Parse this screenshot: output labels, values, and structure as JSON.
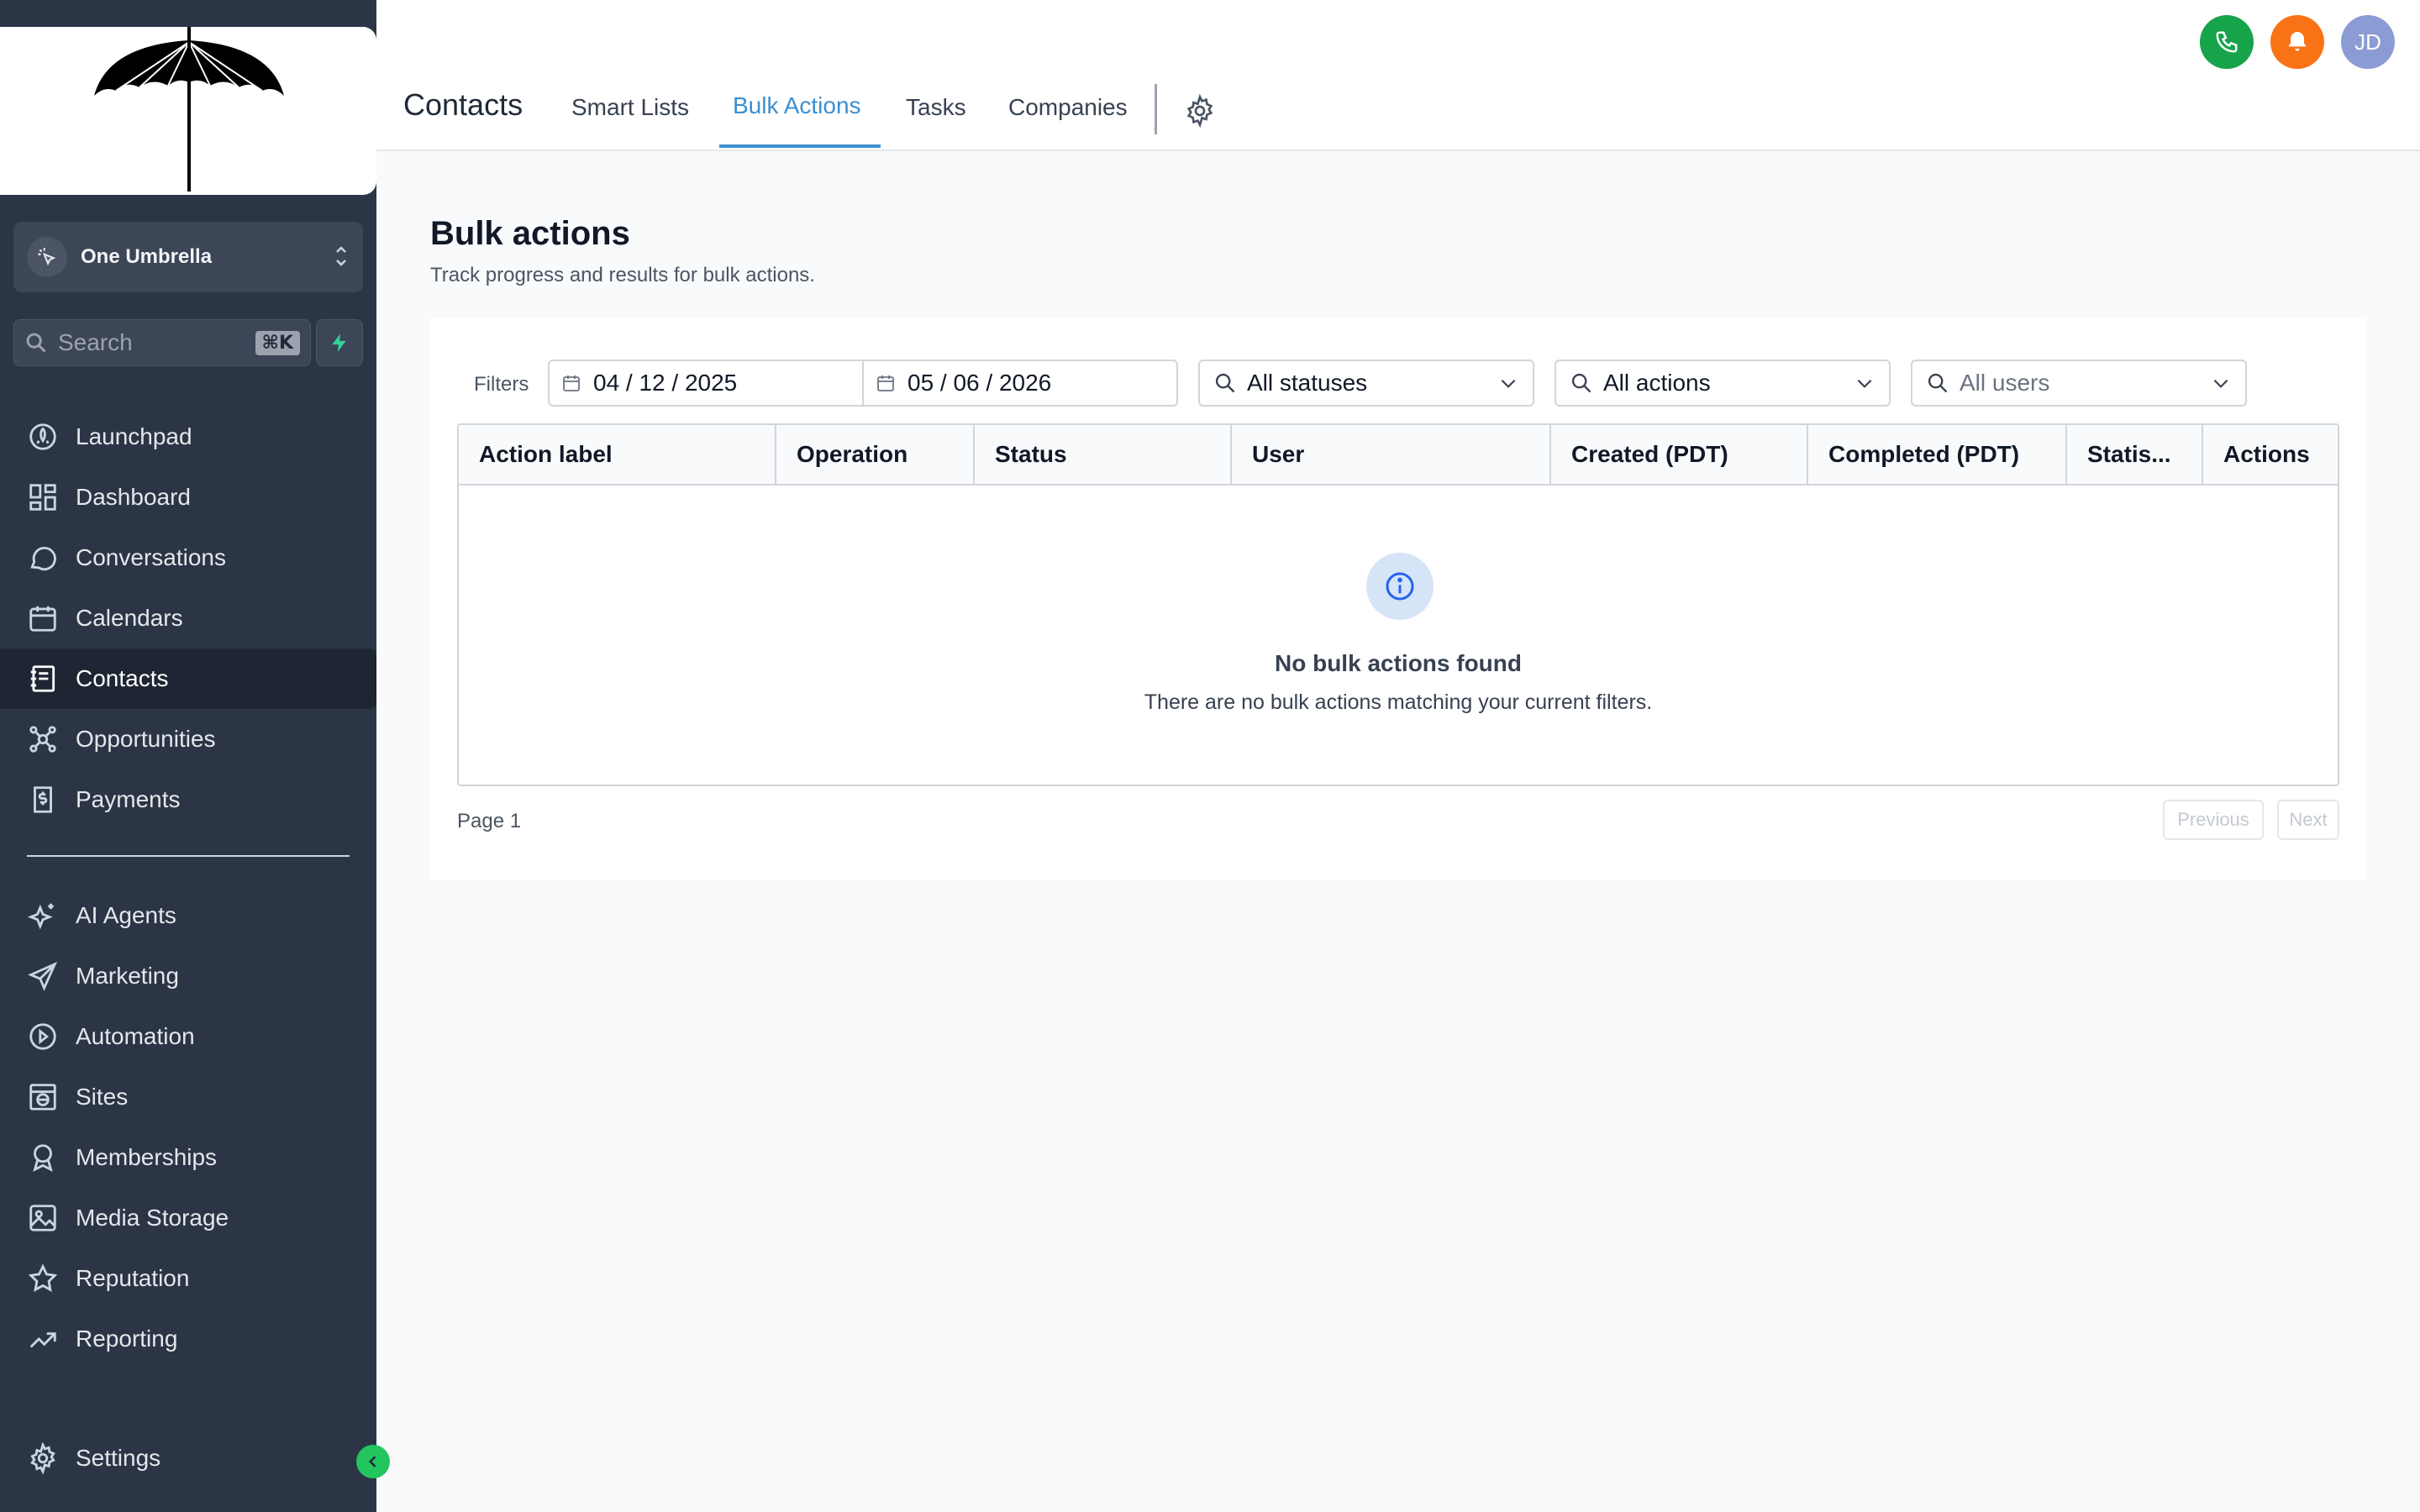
{
  "sidebar": {
    "account_name": "One Umbrella",
    "search_placeholder": "Search",
    "search_shortcut": "⌘K",
    "nav_primary": [
      {
        "label": "Launchpad",
        "icon": "rocket-icon"
      },
      {
        "label": "Dashboard",
        "icon": "grid-icon"
      },
      {
        "label": "Conversations",
        "icon": "chat-bubble-icon"
      },
      {
        "label": "Calendars",
        "icon": "calendar-icon"
      },
      {
        "label": "Contacts",
        "icon": "contact-book-icon",
        "active": true
      },
      {
        "label": "Opportunities",
        "icon": "opportunities-icon"
      },
      {
        "label": "Payments",
        "icon": "invoice-icon"
      }
    ],
    "nav_secondary": [
      {
        "label": "AI Agents",
        "icon": "sparkle-icon"
      },
      {
        "label": "Marketing",
        "icon": "send-icon"
      },
      {
        "label": "Automation",
        "icon": "automation-icon"
      },
      {
        "label": "Sites",
        "icon": "globe-window-icon"
      },
      {
        "label": "Memberships",
        "icon": "badge-icon"
      },
      {
        "label": "Media Storage",
        "icon": "image-icon"
      },
      {
        "label": "Reputation",
        "icon": "star-icon"
      },
      {
        "label": "Reporting",
        "icon": "trend-up-icon"
      }
    ],
    "settings_label": "Settings"
  },
  "header": {
    "title": "Contacts",
    "tabs": [
      {
        "label": "Smart Lists"
      },
      {
        "label": "Bulk Actions",
        "active": true
      },
      {
        "label": "Tasks"
      },
      {
        "label": "Companies"
      }
    ],
    "avatar_initials": "JD",
    "colors": {
      "phone": "#16a34a",
      "bell": "#f97316",
      "avatar": "#8b9bd4",
      "accent": "#3b8fd1"
    }
  },
  "main": {
    "title": "Bulk actions",
    "subtitle": "Track progress and results for bulk actions.",
    "filters": {
      "label": "Filters",
      "date_from": "04 / 12 / 2025",
      "date_to": "05 / 06 / 2026",
      "status": "All statuses",
      "action": "All actions",
      "user_placeholder": "All users"
    },
    "table": {
      "columns": [
        "Action label",
        "Operation",
        "Status",
        "User",
        "Created (PDT)",
        "Completed (PDT)",
        "Statis...",
        "Actions"
      ],
      "rows": [],
      "empty_title": "No bulk actions found",
      "empty_message": "There are no bulk actions matching your current filters."
    },
    "pagination": {
      "page_label": "Page 1",
      "previous": "Previous",
      "next": "Next"
    }
  }
}
